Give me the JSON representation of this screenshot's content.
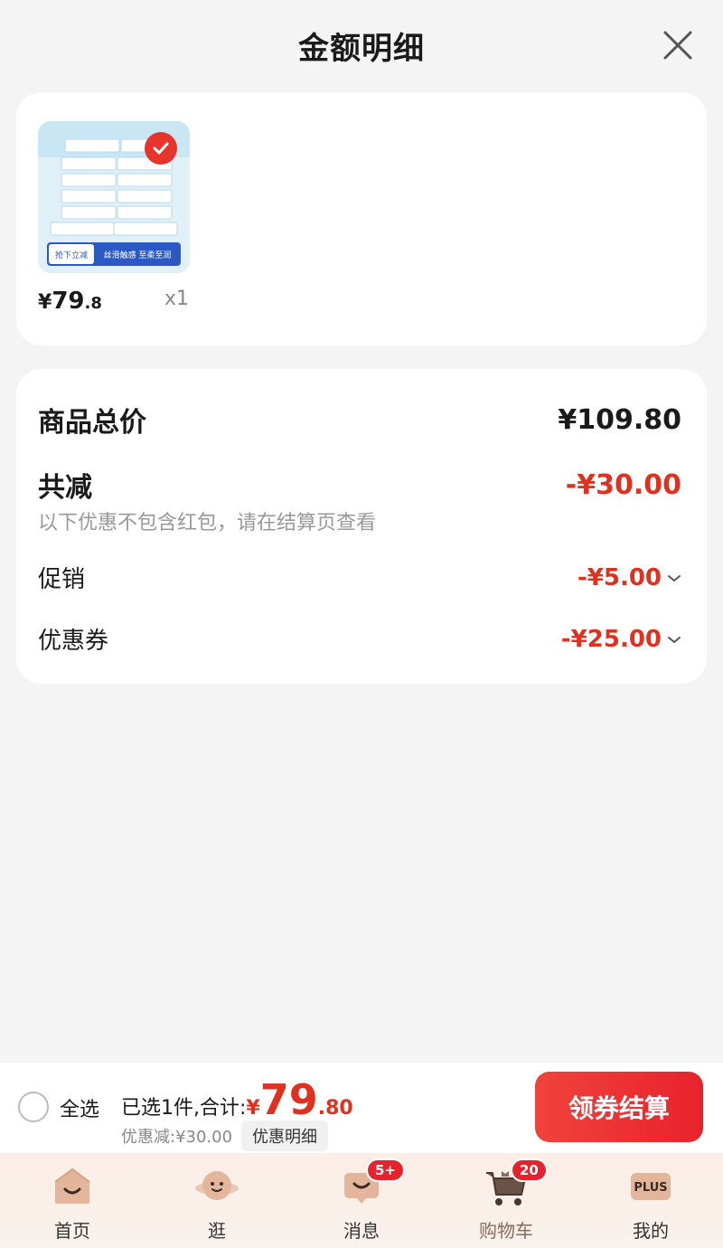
{
  "header": {
    "title": "金额明细"
  },
  "product": {
    "price_currency": "¥",
    "price_int": "79",
    "price_dec": ".8",
    "quantity": "x1",
    "image_texts": [
      "抢下立减",
      "丝滑触感 至柔至润"
    ]
  },
  "summary": {
    "total_label": "商品总价",
    "total_value": "¥109.80",
    "reduce_label": "共减",
    "reduce_value": "-¥30.00",
    "note": "以下优惠不包含红包，请在结算页查看",
    "promo_label": "促销",
    "promo_value": "-¥5.00",
    "coupon_label": "优惠券",
    "coupon_value": "-¥25.00"
  },
  "bottom": {
    "select_all": "全选",
    "selected_text": "已选1件,合计:",
    "total_currency": "¥",
    "total_int": "79",
    "total_dec": ".80",
    "discount_text": "优惠减:¥30.00",
    "detail_label": "优惠明细",
    "checkout_label": "领券结算"
  },
  "tabs": [
    {
      "label": "首页",
      "icon": "home-icon"
    },
    {
      "label": "逛",
      "icon": "planet-face-icon"
    },
    {
      "label": "消息",
      "icon": "message-icon",
      "badge": "5+"
    },
    {
      "label": "购物车",
      "icon": "cart-icon",
      "badge": "20"
    },
    {
      "label": "我的",
      "icon": "plus-icon"
    }
  ],
  "colors": {
    "accent_red": "#e0311f",
    "tab_bg": "#fbeee6"
  }
}
